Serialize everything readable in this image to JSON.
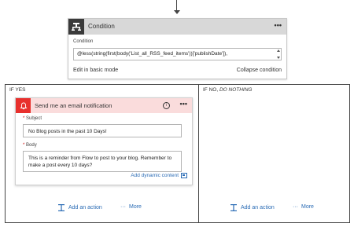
{
  "condition": {
    "title": "Condition",
    "menu": "•••",
    "field_label": "Condition",
    "expression": "@less(string(first(body('List_all_RSS_feed_items'))['publishDate']),",
    "edit_basic": "Edit in basic mode",
    "collapse": "Collapse condition"
  },
  "yes_branch": {
    "title": "IF YES",
    "action": {
      "title": "Send me an email notification",
      "menu": "•••",
      "subject_label": "Subject",
      "subject_value": "No Blog posts in the past 10 Days!",
      "body_label": "Body",
      "body_value": "This is a reminder from Flow to post to your blog. Remember to make a post every 10 days?",
      "add_dynamic": "Add dynamic content"
    },
    "add_action": "Add an action",
    "more": "More"
  },
  "no_branch": {
    "title_prefix": "IF NO, ",
    "title_emphasis": "DO NOTHING",
    "add_action": "Add an action",
    "more": "More"
  },
  "colors": {
    "accent_blue": "#2b6cb5",
    "email_red": "#e8302d",
    "email_header": "#fadcdc",
    "condition_header": "#d8d8d8",
    "condition_icon": "#3a3a3a"
  },
  "icons": {
    "condition": "condition-icon",
    "email": "bell-icon",
    "info": "info-icon",
    "add_action": "add-action-icon"
  }
}
